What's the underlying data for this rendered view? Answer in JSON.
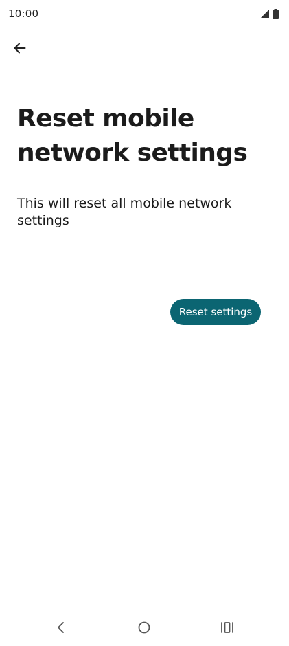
{
  "status_bar": {
    "time": "10:00",
    "icons": [
      "signal-icon",
      "battery-icon"
    ]
  },
  "header": {
    "back_icon": "back-arrow-icon"
  },
  "main": {
    "title": "Reset mobile network settings",
    "description": "This will reset all mobile network settings",
    "reset_button_label": "Reset settings"
  },
  "nav_bar": {
    "icons": [
      "nav-back-icon",
      "nav-home-icon",
      "nav-recents-icon"
    ]
  },
  "colors": {
    "accent": "#0b6572",
    "background": "#ffffff",
    "text": "#1b1b1b"
  }
}
